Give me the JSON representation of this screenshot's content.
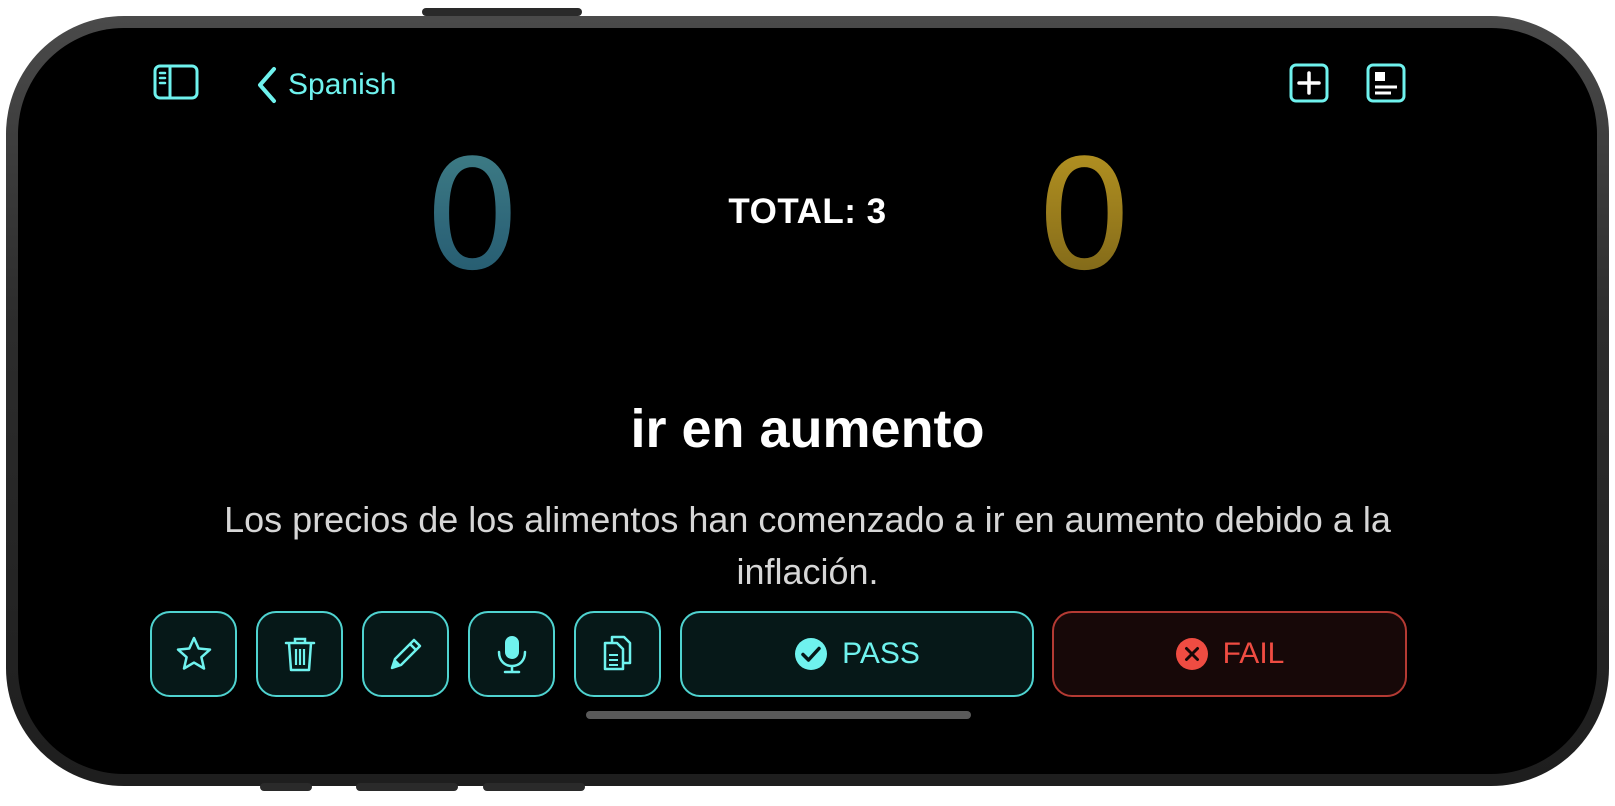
{
  "nav": {
    "back_label": "Spanish",
    "icons": [
      "sidebar-icon",
      "chevron-left-icon",
      "plus-square-icon",
      "note-icon"
    ]
  },
  "scores": {
    "pass_count": "0",
    "fail_count": "0",
    "total_label": "TOTAL: 3"
  },
  "card": {
    "term": "ir en aumento",
    "example": "Los precios de los alimentos han comenzado a ir en aumento debido a la inflación."
  },
  "actions": {
    "icons": [
      "star-icon",
      "trash-icon",
      "pencil-icon",
      "microphone-icon",
      "copy-icon"
    ],
    "pass_label": "PASS",
    "fail_label": "FAIL"
  },
  "colors": {
    "accent": "#6ff2ee",
    "pass_score": "#3f7e86",
    "fail_score": "#b59321",
    "fail": "#ef4c42",
    "background": "#000000"
  }
}
